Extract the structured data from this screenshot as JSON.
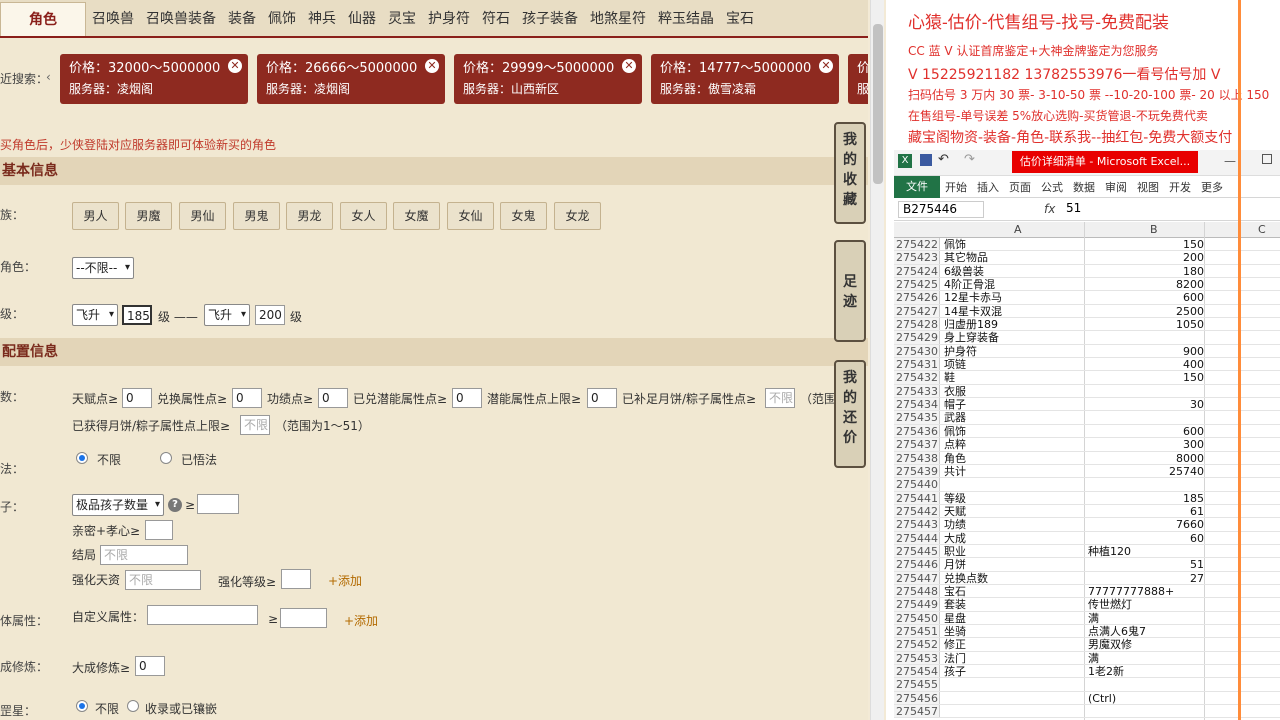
{
  "tabs": [
    "角色",
    "召唤兽",
    "召唤兽装备",
    "装备",
    "佩饰",
    "神兵",
    "仙器",
    "灵宝",
    "护身符",
    "符石",
    "孩子装备",
    "地煞星符",
    "粹玉结晶",
    "宝石"
  ],
  "recent": {
    "label": "近搜索：",
    "chips": [
      {
        "price": "价格：32000～5000000",
        "server": "服务器：凌烟阁"
      },
      {
        "price": "价格：26666～5000000",
        "server": "服务器：凌烟阁"
      },
      {
        "price": "价格：29999～5000000",
        "server": "服务器：山西新区"
      },
      {
        "price": "价格：14777～5000000",
        "server": "服务器：傲雪凌霜"
      },
      {
        "price": "价",
        "server": "服"
      }
    ]
  },
  "notice": "买角色后，少侠登陆对应服务器即可体验新买的角色",
  "basic": {
    "title": "基本信息",
    "race_label": "族：",
    "races": [
      "男人",
      "男魔",
      "男仙",
      "男鬼",
      "男龙",
      "女人",
      "女魔",
      "女仙",
      "女鬼",
      "女龙"
    ],
    "role_label": "角色：",
    "role_value": "--不限--",
    "level_label": "级：",
    "lv_from_sel": "飞升",
    "lv_from": "185",
    "lv_unit": "级 ——",
    "lv_to_sel": "飞升",
    "lv_to": "200",
    "lv_unit2": "级"
  },
  "config": {
    "title": "配置信息",
    "params_label": "数：",
    "tf": "天赋点≥",
    "tf_v": "0",
    "dh": "兑换属性点≥",
    "dh_v": "0",
    "gj": "功绩点≥",
    "gj_v": "0",
    "qn": "已兑潜能属性点≥",
    "qn_v": "0",
    "qnmax": "潜能属性点上限≥",
    "qnmax_v": "0",
    "yb": "已补足月饼/粽子属性点≥",
    "yb_ph": "不限",
    "range1": "（范围",
    "yb2": "已获得月饼/粽子属性点上限≥",
    "yb2_ph": "不限",
    "range2": "（范围为1～51）",
    "wu_label": "法：",
    "wu_opts": [
      "不限",
      "已悟法"
    ],
    "child_label": "子：",
    "child_sel": "极品孩子数量",
    "ge": "≥",
    "qm": "亲密+孝心≥",
    "jj": "结局",
    "jj_ph": "不限",
    "qh": "强化天资",
    "qh_ph": "不限",
    "qhdj": "强化等级≥",
    "add": "+添加",
    "attr_label": "体属性：",
    "custom": "自定义属性：",
    "dc_label": "成修炼：",
    "dc": "大成修炼≥",
    "dc_v": "0",
    "star_label": "罡星：",
    "star_opts": [
      "不限",
      "收录或已镶嵌"
    ]
  },
  "side_buttons": [
    "我的收藏",
    "足迹",
    "我的还价"
  ],
  "promo": {
    "title": "心猿-估价-代售组号-找号-免费配装",
    "l1": "CC 蓝 V 认证首席鉴定+大神金牌鉴定为您服务",
    "l2": "V 15225921182     13782553976一看号估号加 V",
    "l3": "扫码估号 3 万内 30 票- 3-10-50 票  --10-20-100 票- 20 以上 150",
    "l4": "在售组号-单号误差 5%放心选购-买货管退-不玩免费代卖",
    "l5": "藏宝阁物资-装备-角色-联系我--抽红包-免费大额支付"
  },
  "excel": {
    "title": "估价详细清单 - Microsoft Excel...",
    "tabs": [
      "文件",
      "开始",
      "插入",
      "页面",
      "公式",
      "数据",
      "审阅",
      "视图",
      "开发",
      "更多"
    ],
    "cellref": "B275446",
    "fx": "fx",
    "formula": "51",
    "cols": [
      "A",
      "B",
      "C"
    ],
    "rows": [
      [
        "275422",
        "佩饰",
        "150"
      ],
      [
        "275423",
        "其它物品",
        "200"
      ],
      [
        "275424",
        "6级兽装",
        "180"
      ],
      [
        "275425",
        "4阶正骨混",
        "8200"
      ],
      [
        "275426",
        "12星卡赤马",
        "600"
      ],
      [
        "275427",
        "14星卡双混",
        "2500"
      ],
      [
        "275428",
        "归虚册189",
        "1050"
      ],
      [
        "275429",
        "身上穿装备",
        ""
      ],
      [
        "275430",
        "护身符",
        "900"
      ],
      [
        "275431",
        "项链",
        "400"
      ],
      [
        "275432",
        "鞋",
        "150"
      ],
      [
        "275433",
        "衣服",
        ""
      ],
      [
        "275434",
        "帽子",
        "30"
      ],
      [
        "275435",
        "武器",
        ""
      ],
      [
        "275436",
        "佩饰",
        "600"
      ],
      [
        "275437",
        "点粹",
        "300"
      ],
      [
        "275438",
        "角色",
        "8000"
      ],
      [
        "275439",
        "共计",
        "25740"
      ],
      [
        "275440",
        "",
        ""
      ],
      [
        "275441",
        "等级",
        "185"
      ],
      [
        "275442",
        "天赋",
        "61"
      ],
      [
        "275443",
        "功绩",
        "7660"
      ],
      [
        "275444",
        "大成",
        "60"
      ],
      [
        "275445",
        "职业",
        "种植120"
      ],
      [
        "275446",
        "月饼",
        "51"
      ],
      [
        "275447",
        "兑换点数",
        "27"
      ],
      [
        "275448",
        "宝石",
        "77777777888+"
      ],
      [
        "275449",
        "套装",
        "传世燃灯"
      ],
      [
        "275450",
        "星盘",
        "满"
      ],
      [
        "275451",
        "坐骑",
        "点满人6鬼7"
      ],
      [
        "275452",
        "修正",
        "男魔双修"
      ],
      [
        "275453",
        "法门",
        "满"
      ],
      [
        "275454",
        "孩子",
        "1老2新"
      ],
      [
        "275455",
        "",
        ""
      ],
      [
        "275456",
        "",
        "(Ctrl)"
      ],
      [
        "275457",
        "",
        ""
      ]
    ]
  }
}
